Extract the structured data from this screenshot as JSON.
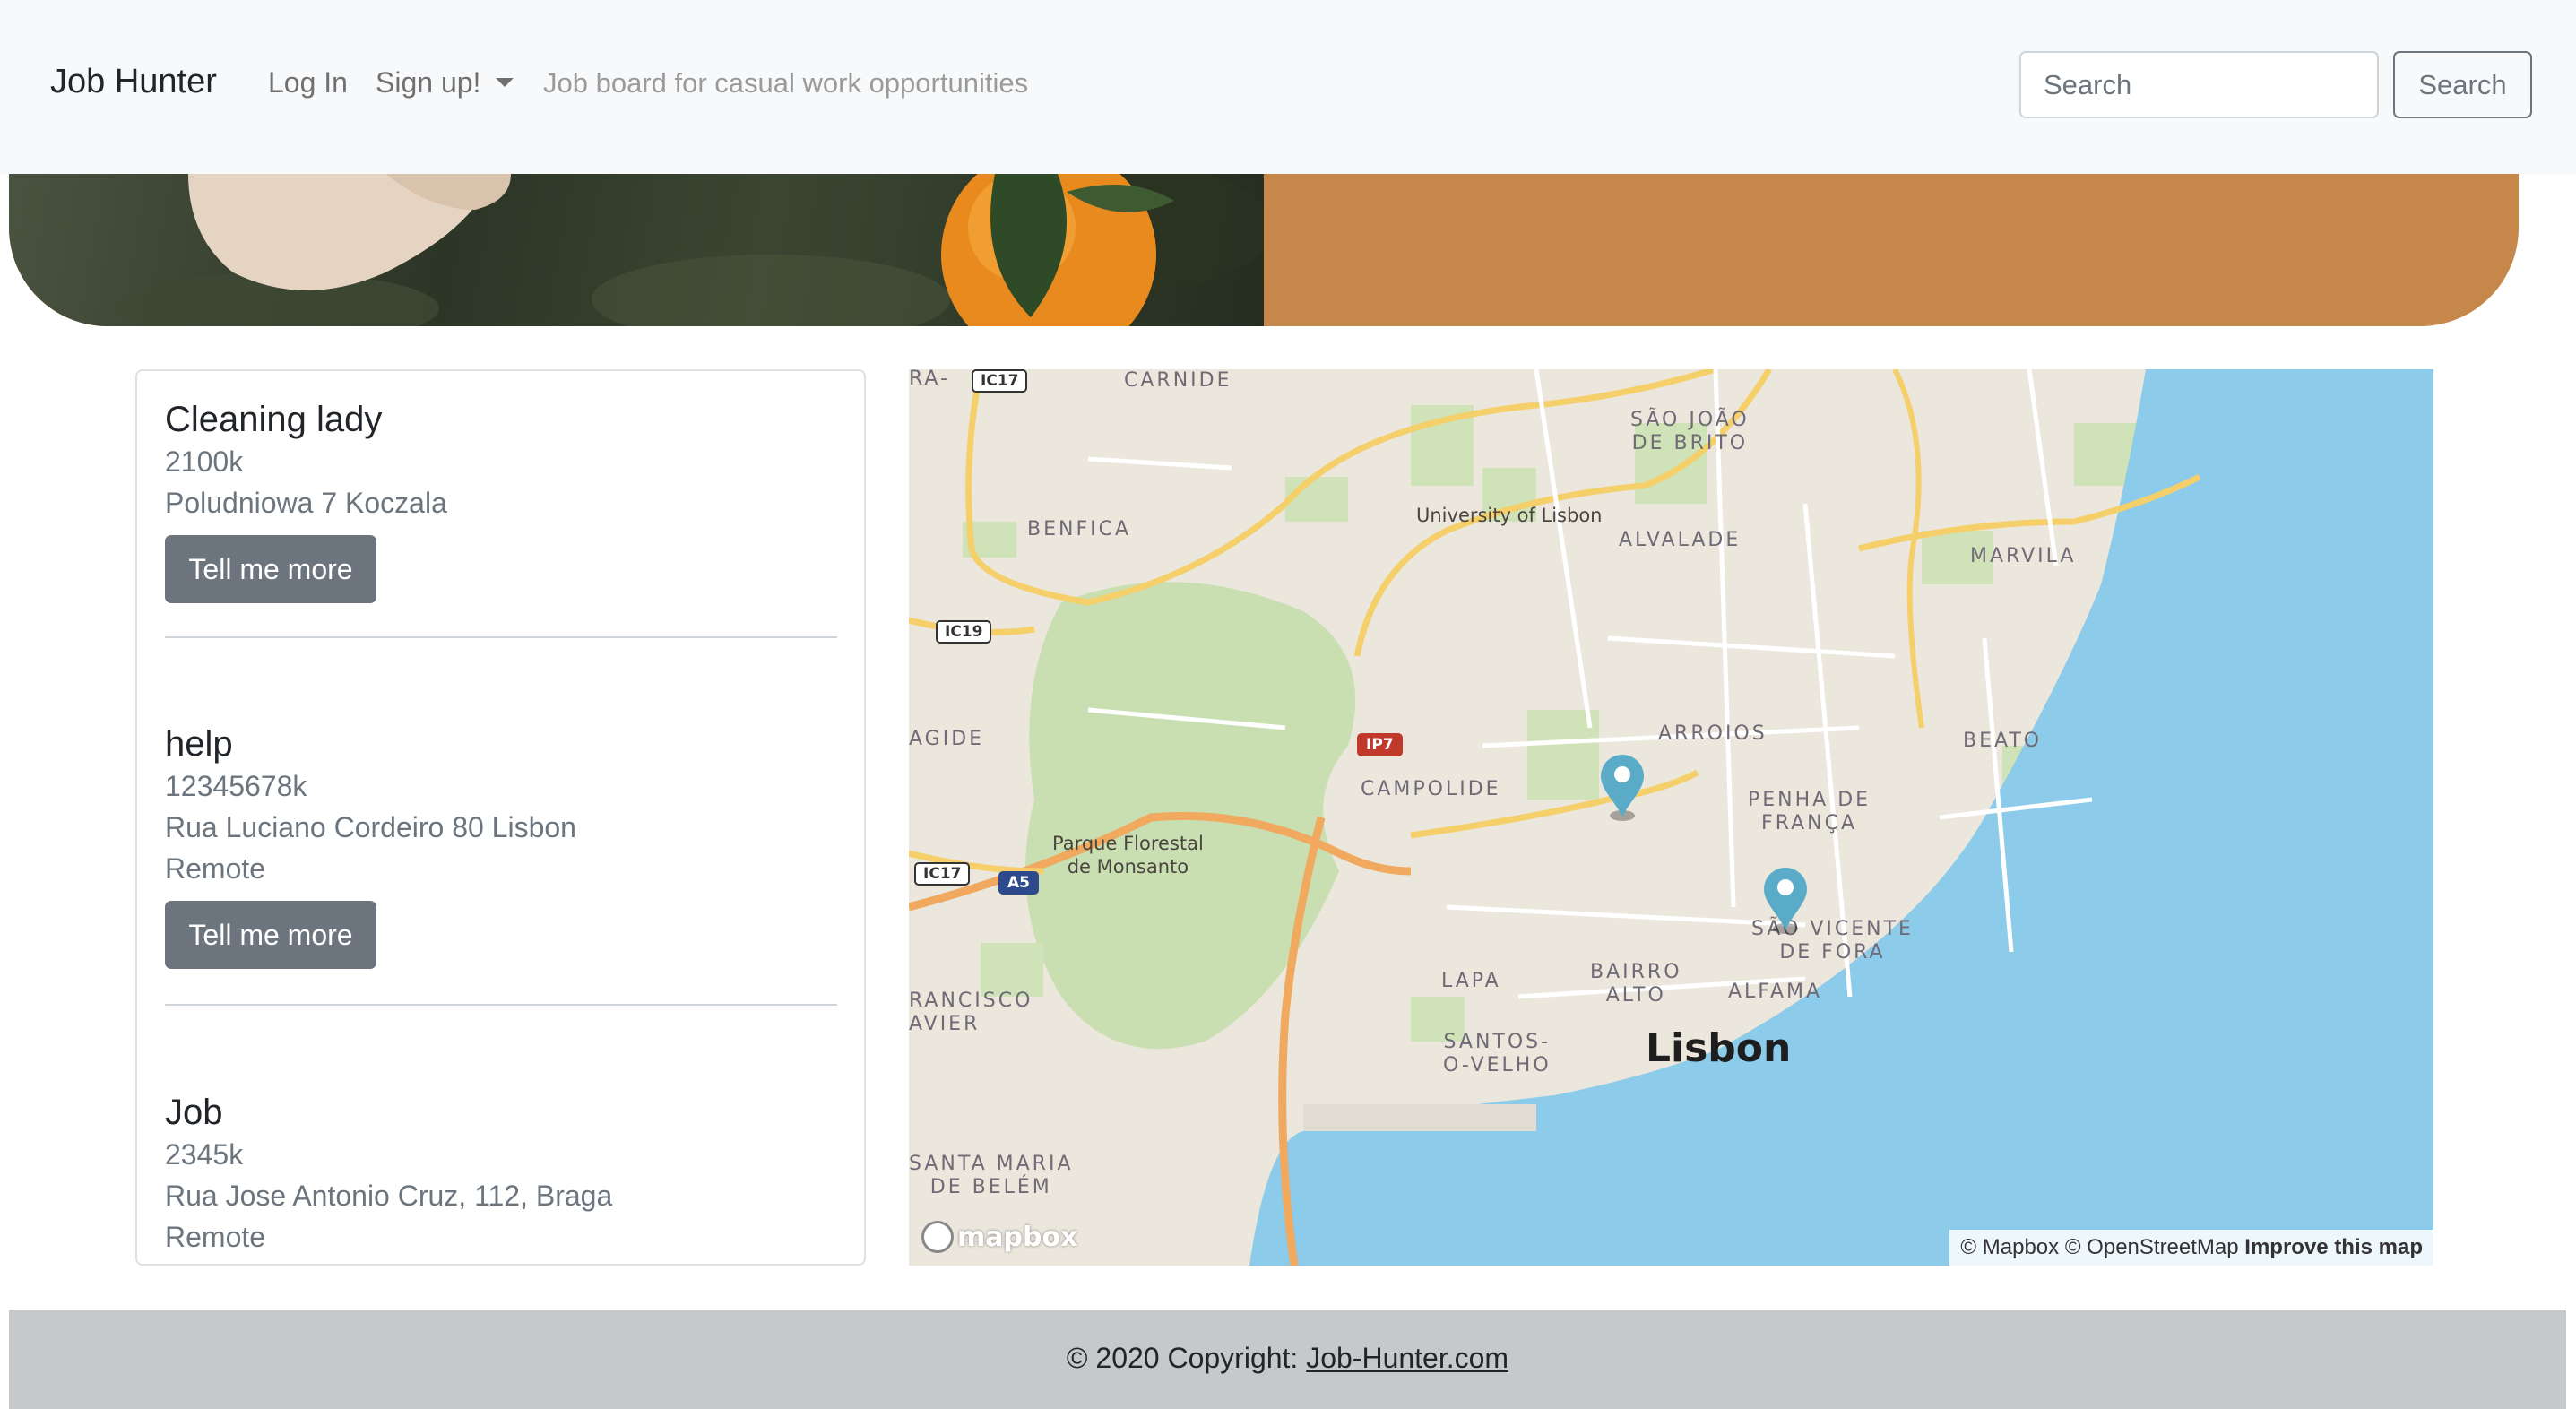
{
  "navbar": {
    "brand": "Job Hunter",
    "login": "Log In",
    "signup": "Sign up!",
    "tagline": "Job board for casual work opportunities",
    "search_placeholder": "Search",
    "search_button": "Search"
  },
  "jobs": [
    {
      "title": "Cleaning lady",
      "pay": "2100k",
      "address": "Poludniowa 7 Koczala",
      "remote": "",
      "button": "Tell me more"
    },
    {
      "title": "help",
      "pay": "12345678k",
      "address": "Rua Luciano Cordeiro 80 Lisbon",
      "remote": "Remote",
      "button": "Tell me more"
    },
    {
      "title": "Job",
      "pay": "2345k",
      "address": "Rua Jose Antonio Cruz, 112, Braga",
      "remote": "Remote"
    }
  ],
  "map": {
    "city": "Lisbon",
    "labels": {
      "carnide": "CARNIDE",
      "sao_joao": "SÃO JOÃO\nDE BRITO",
      "benfica": "BENFICA",
      "university": "University of Lisbon",
      "alvalade": "ALVALADE",
      "marvila": "MARVILA",
      "agide": "AGIDE",
      "arroios": "ARROIOS",
      "beato": "BEATO",
      "campolide": "CAMPOLIDE",
      "penha": "PENHA DE\nFRANÇA",
      "parque": "Parque Florestal\nde Monsanto",
      "sao_vicente": "SÃO VICENTE\nDE FORA",
      "lapa": "LAPA",
      "bairro": "BAIRRO\nALTO",
      "alfama": "ALFAMA",
      "rancisco": "RANCISCO\nAVIER",
      "santos": "SANTOS-\nO-VELHO",
      "santa_maria": "SANTA MARIA\nDE BELÉM",
      "ra": "RA-"
    },
    "shields": {
      "ic17a": "IC17",
      "ic19": "IC19",
      "ip7": "IP7",
      "ic17b": "IC17",
      "a5": "A5"
    },
    "logo": "mapbox",
    "attribution_mapbox": "© Mapbox",
    "attribution_osm": "© OpenStreetMap",
    "attribution_improve": "Improve this map",
    "water_color": "#8ccbe9",
    "land_color": "#ece7dd",
    "marker_color": "#5aabc8"
  },
  "footer": {
    "copyright": "© 2020 Copyright: ",
    "link": "Job-Hunter.com"
  },
  "colors": {
    "hero_accent": "#c5874a",
    "button_gray": "#6c757d",
    "footer_bg": "#c6c8ca"
  }
}
